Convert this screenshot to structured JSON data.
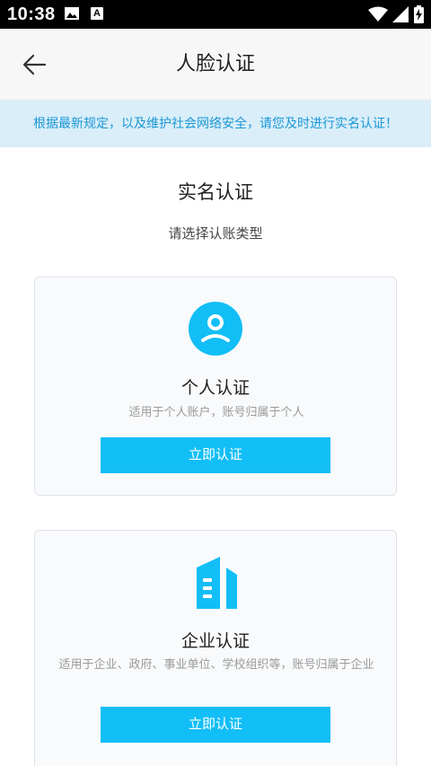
{
  "status_bar": {
    "time": "10:38",
    "notification_a": "A"
  },
  "header": {
    "title": "人脸认证"
  },
  "notice": {
    "text": "根据最新规定，以及维护社会网络安全，请您及时进行实名认证！"
  },
  "section": {
    "title": "实名认证",
    "subtitle": "请选择认账类型"
  },
  "cards": [
    {
      "title": "个人认证",
      "description": "适用于个人账户，账号归属于个人",
      "button_label": "立即认证",
      "icon": "user-icon"
    },
    {
      "title": "企业认证",
      "description": "适用于企业、政府、事业单位、学校组织等，账号归属于企业",
      "button_label": "立即认证",
      "icon": "building-icon"
    }
  ],
  "colors": {
    "accent": "#12bef6",
    "notice_bg": "#d9eef9",
    "notice_text": "#1a97d6",
    "header_bg": "#f7f7f7"
  }
}
